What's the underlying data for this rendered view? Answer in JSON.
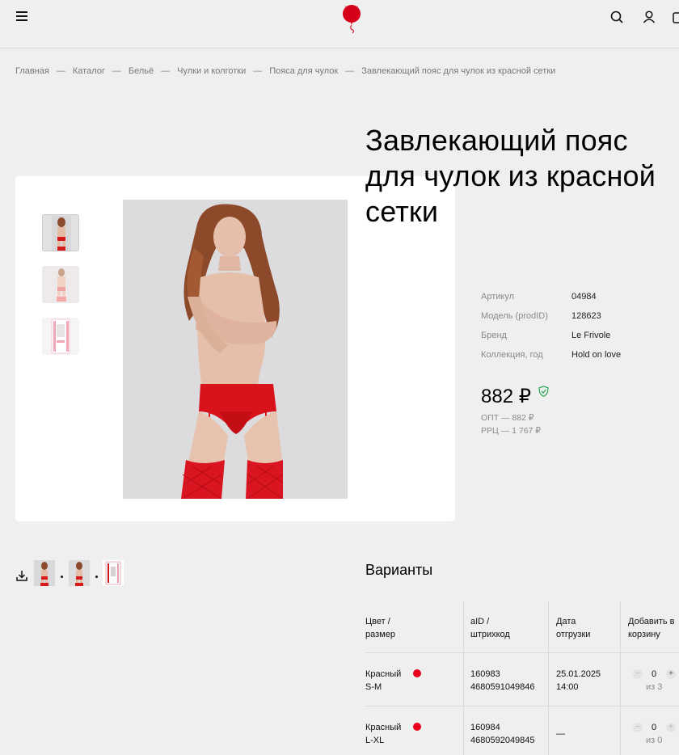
{
  "header": {
    "menu_icon": "hamburger-icon",
    "logo": "devil-balloon-logo",
    "icons": [
      "search-icon",
      "user-icon",
      "cart-icon"
    ]
  },
  "breadcrumb": {
    "items": [
      "Главная",
      "Каталог",
      "Бельё",
      "Чулки и колготки",
      "Пояса для чулок",
      "Завлекающий пояс для чулок из красной сетки"
    ],
    "separator": "—"
  },
  "product": {
    "title": "Завлекающий пояс для чулок из красной сетки",
    "specs": [
      {
        "label": "Артикул",
        "value": "04984"
      },
      {
        "label": "Модель (prodID)",
        "value": "128623"
      },
      {
        "label": "Бренд",
        "value": "Le Frivole"
      },
      {
        "label": "Коллекция, год",
        "value": "Hold on love"
      }
    ],
    "price": "882 ₽",
    "opt_price": "ОПТ — 882 ₽",
    "rrc_price": "РРЦ — 1 767 ₽"
  },
  "variants": {
    "title": "Варианты",
    "columns": [
      "Цвет / размер",
      "aID / штрихкод",
      "Дата отгрузки",
      "Добавить в корзину"
    ],
    "rows": [
      {
        "color": "Красный",
        "size": "S-M",
        "color_hex": "#e8001c",
        "aid": "160983",
        "barcode": "4680591049846",
        "date": "25.01.2025",
        "time": "14:00",
        "qty": "0",
        "max": "из 3"
      },
      {
        "color": "Красный",
        "size": "L-XL",
        "color_hex": "#e8001c",
        "aid": "160984",
        "barcode": "4680592049845",
        "date": "—",
        "time": "",
        "qty": "0",
        "max": "из 0"
      }
    ]
  },
  "colors": {
    "accent": "#e8001c",
    "background": "#efefef",
    "shield": "#1fa34a"
  }
}
